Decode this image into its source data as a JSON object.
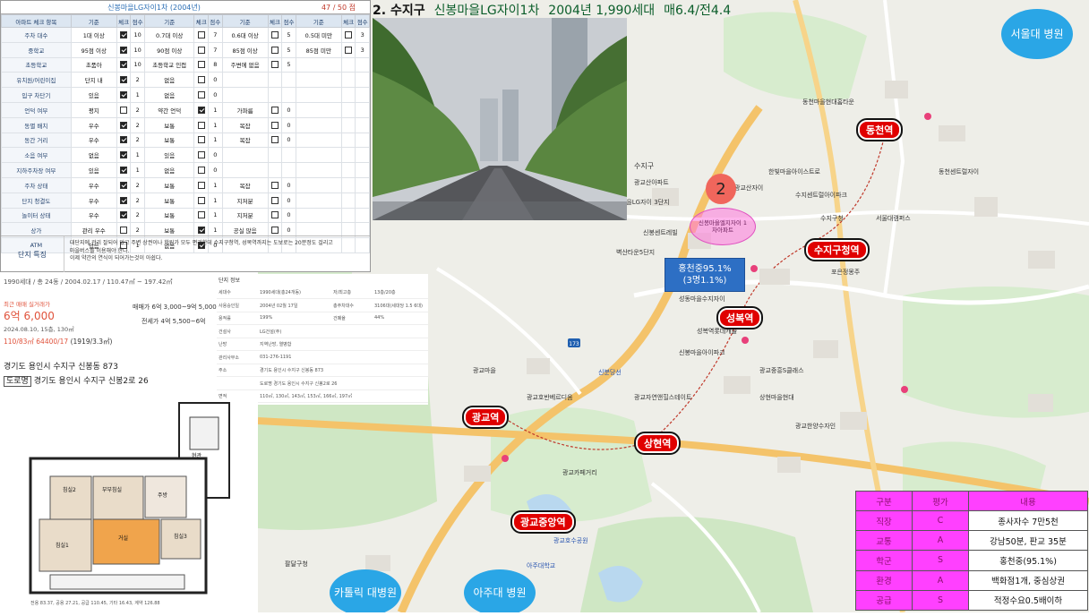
{
  "title": {
    "number": "2.",
    "district": "수지구",
    "complex": "신봉마을LG자이1차",
    "year_households": "2004년 1,990세대",
    "price": "매6.4/전4.4"
  },
  "checklist": {
    "header": "신봉마을LG자이1차 (2004년)",
    "score": "47 / 50 점",
    "columns": [
      "아파트 체크 항목",
      "기준",
      "체크",
      "점수",
      "기준",
      "체크",
      "점수",
      "기준",
      "체크",
      "점수",
      "기준",
      "체크",
      "점수"
    ],
    "rows": [
      {
        "item": "주차 대수",
        "c": [
          [
            "1대 이상",
            true,
            "10"
          ],
          [
            "0.7대 이상",
            false,
            "7"
          ],
          [
            "0.6대 이상",
            false,
            "5"
          ],
          [
            "0.5대 미만",
            false,
            "3"
          ]
        ]
      },
      {
        "item": "중학교",
        "c": [
          [
            "95점 이상",
            true,
            "10"
          ],
          [
            "90점 이상",
            false,
            "7"
          ],
          [
            "85점 이상",
            false,
            "5"
          ],
          [
            "85점 미만",
            false,
            "3"
          ]
        ]
      },
      {
        "item": "초등학교",
        "c": [
          [
            "초품아",
            true,
            "10"
          ],
          [
            "초등학교 인접",
            false,
            "8"
          ],
          [
            "주변에 없음",
            false,
            "5"
          ],
          [
            "",
            null,
            ""
          ]
        ]
      },
      {
        "item": "유치원/어린이집",
        "c": [
          [
            "단지 내",
            true,
            "2"
          ],
          [
            "없음",
            false,
            "0"
          ],
          [
            "",
            null,
            ""
          ],
          [
            "",
            null,
            ""
          ]
        ]
      },
      {
        "item": "입구 차단기",
        "c": [
          [
            "있음",
            true,
            "1"
          ],
          [
            "없음",
            false,
            "0"
          ],
          [
            "",
            null,
            ""
          ],
          [
            "",
            null,
            ""
          ]
        ]
      },
      {
        "item": "언덕 여부",
        "c": [
          [
            "평지",
            false,
            "2"
          ],
          [
            "약간 언덕",
            true,
            "1"
          ],
          [
            "가파름",
            false,
            "0"
          ],
          [
            "",
            null,
            ""
          ]
        ]
      },
      {
        "item": "동별 배치",
        "c": [
          [
            "우수",
            true,
            "2"
          ],
          [
            "보통",
            false,
            "1"
          ],
          [
            "복잡",
            false,
            "0"
          ],
          [
            "",
            null,
            ""
          ]
        ]
      },
      {
        "item": "동간 거리",
        "c": [
          [
            "우수",
            true,
            "2"
          ],
          [
            "보통",
            false,
            "1"
          ],
          [
            "복잡",
            false,
            "0"
          ],
          [
            "",
            null,
            ""
          ]
        ]
      },
      {
        "item": "소음 여부",
        "c": [
          [
            "없음",
            true,
            "1"
          ],
          [
            "있음",
            false,
            "0"
          ],
          [
            "",
            null,
            ""
          ],
          [
            "",
            null,
            ""
          ]
        ]
      },
      {
        "item": "지하주차장 여부",
        "c": [
          [
            "있음",
            true,
            "1"
          ],
          [
            "없음",
            false,
            "0"
          ],
          [
            "",
            null,
            ""
          ],
          [
            "",
            null,
            ""
          ]
        ]
      },
      {
        "item": "주차 상태",
        "c": [
          [
            "우수",
            true,
            "2"
          ],
          [
            "보통",
            false,
            "1"
          ],
          [
            "복잡",
            false,
            "0"
          ],
          [
            "",
            null,
            ""
          ]
        ]
      },
      {
        "item": "단지 청결도",
        "c": [
          [
            "우수",
            true,
            "2"
          ],
          [
            "보통",
            false,
            "1"
          ],
          [
            "지저분",
            false,
            "0"
          ],
          [
            "",
            null,
            ""
          ]
        ]
      },
      {
        "item": "놀이터 상태",
        "c": [
          [
            "우수",
            true,
            "2"
          ],
          [
            "보통",
            false,
            "1"
          ],
          [
            "지저분",
            false,
            "0"
          ],
          [
            "",
            null,
            ""
          ]
        ]
      },
      {
        "item": "상가",
        "c": [
          [
            "관리 우수",
            false,
            "2"
          ],
          [
            "보통",
            true,
            "1"
          ],
          [
            "공실 많음",
            false,
            "0"
          ],
          [
            "",
            null,
            ""
          ]
        ]
      },
      {
        "item": "ATM",
        "c": [
          [
            "있음",
            false,
            "1"
          ],
          [
            "없음",
            true,
            "0"
          ],
          [
            "",
            null,
            ""
          ],
          [
            "",
            null,
            ""
          ]
        ]
      }
    ],
    "note_label": "단지 특징",
    "note_text": [
      "대단지에 관리 잘되어 있고 주변 상권이나 학원가 모두 편리한데 수지구청역, 성복역까지는 도보로는 20분정도 걸리고",
      "마을버스를 이용해야 한다.",
      "이제 약간의 연식이 되어가는것이 아쉽다."
    ]
  },
  "info": {
    "summary": "1990세대 / 총 24동 / 2004.02.17 / 110.47㎡ ~ 197.42㎡",
    "recent_label": "최근 매매 실거래가",
    "recent_price": "6억 6,000",
    "recent_date": "2024.08.10, 15층, 130㎡",
    "sale_range": "매매가 6억 3,000~9억 5,000",
    "rent_range": "전세가 4억 5,500~6억",
    "price_per": "110/83㎡  64400/17 ",
    "price_per_extra": "(1919/3.3㎡)",
    "address": "경기도 용인시 수지구 신봉동 873",
    "road_tag": "도로명",
    "road_address": "경기도 용인시 수지구 신봉2로 26"
  },
  "details": {
    "title": "단지 정보",
    "rows": [
      [
        "세대수",
        "1990세대(총24개동)",
        "저/최고층",
        "13층/20층"
      ],
      [
        "사용승인일",
        "2004년 02월 17일",
        "총주차대수",
        "3106대(세대당 1.5 6대)"
      ],
      [
        "용적률",
        "199%",
        "건폐율",
        "44%"
      ],
      [
        "건설사",
        "LG건설(주)",
        "",
        ""
      ],
      [
        "난방",
        "지역난방, 열병합",
        "",
        ""
      ],
      [
        "관리사무소",
        "031-276-1191",
        "",
        ""
      ],
      [
        "주소",
        "경기도 용인시 수지구 신봉동 873",
        "",
        ""
      ],
      [
        "",
        "도로명  경기도 용인시 수지구 신봉2로 26",
        "",
        ""
      ],
      [
        "면적",
        "110㎡, 130㎡, 143㎡, 153㎡, 166㎡, 197㎡",
        "",
        ""
      ]
    ]
  },
  "plan": {
    "rooms": [
      "침실2",
      "부부침실",
      "침실3",
      "거실",
      "침실1",
      "주방",
      "현관"
    ],
    "footer": "전용 83.37, 공용 27.21, 공급 110.45, 기타 16.43, 계약 126.88"
  },
  "stations": [
    "동천역",
    "수지구청역",
    "성복역",
    "광교역",
    "상현역",
    "광교중앙역"
  ],
  "hospitals": [
    "서울대 병원",
    "카톨릭 대병원",
    "아주대 병원"
  ],
  "marker": {
    "number": "2",
    "label": "신봉마을엘지자이 1차아파트"
  },
  "school_callout": [
    "홍천중95.1%",
    "(3명1.1%)"
  ],
  "map_labels": [
    "수지구",
    "광교산아파트",
    "신봉마을LG자이 3단지",
    "벽산타운5단지",
    "신봉센트레빌",
    "동천마을현대홈타운",
    "동천센트럴자이",
    "한빛마을아이스트로",
    "수지센트럴아이파크",
    "광교산자이",
    "성동마을수지자이",
    "성복역롯데캐슬",
    "광교마을",
    "광교호반베르디움",
    "광교자연앤힐스테이트",
    "광교중흥S클래스",
    "광교한양수자인",
    "상현마을현대",
    "광교호수공원",
    "광교카페거리",
    "신분당선",
    "수지구청",
    "포은정몽주",
    "서울대캠퍼스",
    "신봉마을아이파크",
    "아주대학교",
    "팔달구청"
  ],
  "evaluation": {
    "headers": [
      "구분",
      "평가",
      "내용"
    ],
    "rows": [
      [
        "직장",
        "C",
        "종사자수 7만5천"
      ],
      [
        "교통",
        "A",
        "강남50분, 판교 35분"
      ],
      [
        "학군",
        "S",
        "홍천중(95.1%)"
      ],
      [
        "환경",
        "A",
        "백화점1개, 중심상권"
      ],
      [
        "공급",
        "S",
        "적정수요0.5배이하"
      ]
    ]
  },
  "colors": {
    "station": "#e00000",
    "hospital": "#2aa6e6",
    "eval_header": "#ff40ff",
    "map_bg": "#eeeee8",
    "green": "#cfe7c4"
  }
}
